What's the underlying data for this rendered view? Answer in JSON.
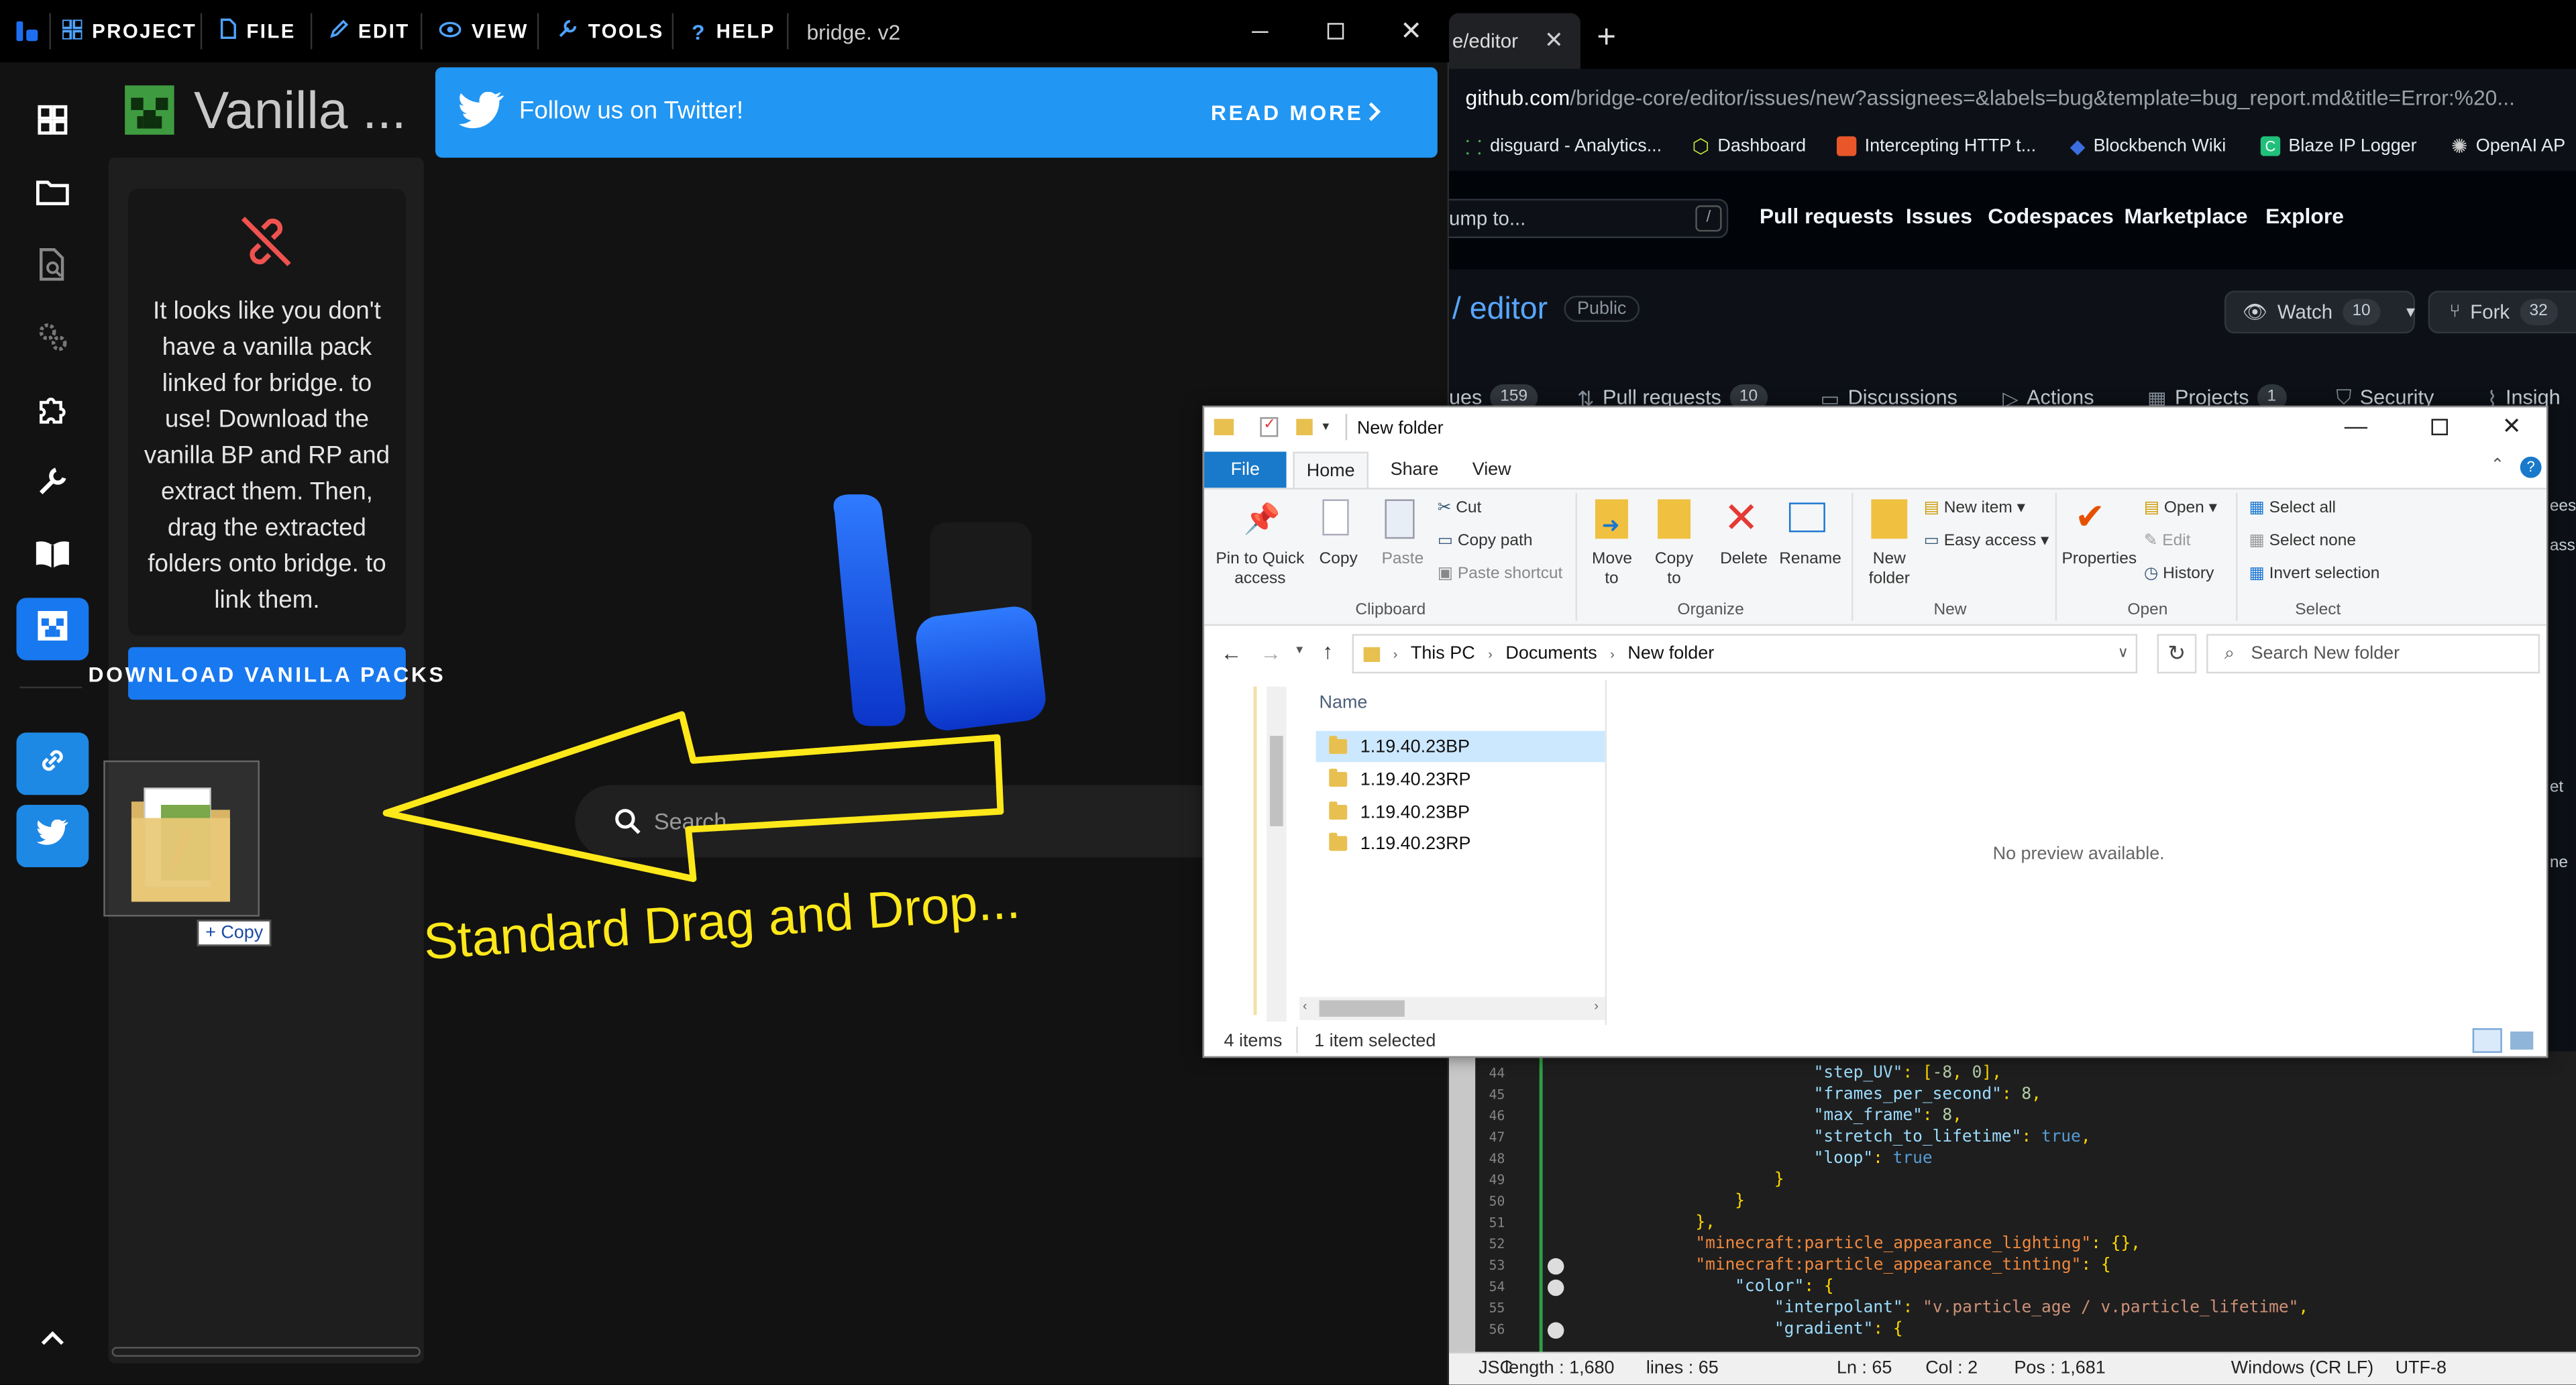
{
  "bridge": {
    "menu": {
      "project": "PROJECT",
      "file": "FILE",
      "edit": "EDIT",
      "view": "VIEW",
      "tools": "TOOLS",
      "help": "HELP"
    },
    "window_title": "bridge. v2",
    "sidebar_title": "Vanilla ...",
    "no_pack_message": "It looks like you don't have a vanilla pack linked for bridge. to use! Download the vanilla BP and RP and extract them. Then, drag the extracted folders onto bridge. to link them.",
    "download_button": "DOWNLOAD VANILLA PACKS",
    "twitter_banner": {
      "text": "Follow us on Twitter!",
      "action": "READ MORE"
    },
    "search_placeholder": "Search",
    "drag_copy_label": "+ Copy",
    "annotation_text": "Standard Drag and Drop..."
  },
  "browser": {
    "tab_title": "e/editor",
    "url_host": "github.com",
    "url_path": "/bridge-core/editor/issues/new?assignees=&labels=bug&template=bug_report.md&title=Error:%20...",
    "bookmarks": [
      "disguard - Analytics...",
      "Dashboard",
      "Intercepting HTTP t...",
      "Blockbench Wiki",
      "Blaze IP Logger",
      "OpenAI AP"
    ],
    "github": {
      "jump_placeholder": "ump to...",
      "slash_key": "/",
      "nav": [
        "Pull requests",
        "Issues",
        "Codespaces",
        "Marketplace",
        "Explore"
      ],
      "repo_name": "/ editor",
      "visibility": "Public",
      "watch_label": "Watch",
      "watch_count": "10",
      "fork_label": "Fork",
      "fork_count": "32",
      "tabs": [
        {
          "label": "ues",
          "count": "159"
        },
        {
          "label": "Pull requests",
          "count": "10"
        },
        {
          "label": "Discussions",
          "count": ""
        },
        {
          "label": "Actions",
          "count": ""
        },
        {
          "label": "Projects",
          "count": "1"
        },
        {
          "label": "Security",
          "count": ""
        },
        {
          "label": "Insigh",
          "count": ""
        }
      ],
      "side_fragments": [
        "ees",
        "ass",
        "et",
        "ne"
      ]
    },
    "code_lines": [
      {
        "n": "44",
        "k": "\"step_UV\"",
        "v": ": [-8, 0],",
        "ind": 206
      },
      {
        "n": "45",
        "k": "\"frames_per_second\"",
        "v": ": 8,",
        "ind": 206
      },
      {
        "n": "46",
        "k": "\"max_frame\"",
        "v": ": 8,",
        "ind": 206
      },
      {
        "n": "47",
        "k": "\"stretch_to_lifetime\"",
        "v": ": true,",
        "ind": 206
      },
      {
        "n": "48",
        "k": "\"loop\"",
        "v": ": true",
        "ind": 206
      },
      {
        "n": "49",
        "k": "",
        "v": "}",
        "ind": 182
      },
      {
        "n": "50",
        "k": "",
        "v": "}",
        "ind": 158
      },
      {
        "n": "51",
        "k": "",
        "v": "},",
        "ind": 134
      },
      {
        "n": "52",
        "k": "\"minecraft:particle_appearance_lighting\"",
        "v": ": {},",
        "ind": 134
      },
      {
        "n": "53",
        "k": "\"minecraft:particle_appearance_tinting\"",
        "v": ": {",
        "ind": 134
      },
      {
        "n": "54",
        "k": "\"color\"",
        "v": ": {",
        "ind": 158
      },
      {
        "n": "55",
        "k": "\"interpolant\"",
        "v": ": \"v.particle_age / v.particle_lifetime\",",
        "ind": 182
      },
      {
        "n": "56",
        "k": "\"gradient\"",
        "v": ": {",
        "ind": 182
      }
    ],
    "status_bar": {
      "lang": "JSC",
      "length": "length : 1,680",
      "lines": "lines : 65",
      "ln": "Ln : 65",
      "col": "Col : 2",
      "pos": "Pos : 1,681",
      "eol": "Windows (CR LF)",
      "enc": "UTF-8"
    }
  },
  "explorer": {
    "title": "New folder",
    "tabs": {
      "file": "File",
      "home": "Home",
      "share": "Share",
      "view": "View"
    },
    "ribbon": {
      "pin": "Pin to Quick access",
      "copy": "Copy",
      "paste": "Paste",
      "cut": "Cut",
      "copy_path": "Copy path",
      "paste_shortcut": "Paste shortcut",
      "move_to": "Move to",
      "copy_to": "Copy to",
      "delete": "Delete",
      "rename": "Rename",
      "new_folder": "New folder",
      "new_item": "New item",
      "easy_access": "Easy access",
      "properties": "Properties",
      "open": "Open",
      "edit": "Edit",
      "history": "History",
      "select_all": "Select all",
      "select_none": "Select none",
      "invert_selection": "Invert selection"
    },
    "groups": {
      "clipboard": "Clipboard",
      "organize": "Organize",
      "new": "New",
      "open": "Open",
      "select": "Select"
    },
    "breadcrumb": [
      "This PC",
      "Documents",
      "New folder"
    ],
    "search_placeholder": "Search New folder",
    "column_name": "Name",
    "files": [
      "1.19.40.23BP",
      "1.19.40.23RP",
      "1.19.40.23BP",
      "1.19.40.23RP"
    ],
    "preview_text": "No preview available.",
    "status_items": "4 items",
    "status_selected": "1 item selected"
  },
  "colors": {
    "bridge_blue": "#1878ef",
    "twitter_blue": "#2196f3",
    "annotation_yellow": "#ffe81a",
    "creeper_green": "#3f9b3f"
  }
}
